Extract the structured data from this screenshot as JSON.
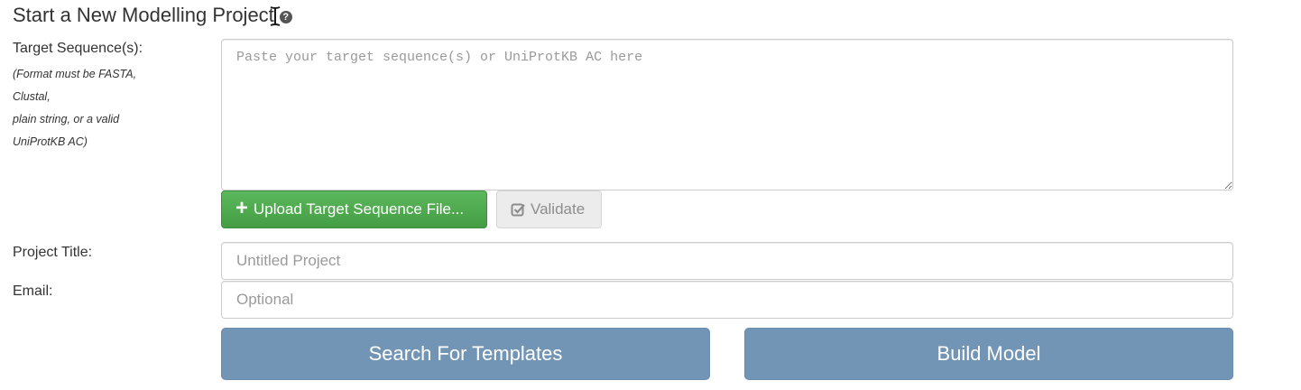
{
  "header": {
    "title": "Start a New Modelling Project",
    "help_icon": "question-circle-icon",
    "help_glyph": "?"
  },
  "form": {
    "sequence": {
      "label": "Target Sequence(s):",
      "hint_lines": [
        "(Format must be FASTA,",
        "Clustal,",
        "plain string, or a valid",
        "UniProtKB AC)"
      ],
      "placeholder": "Paste your target sequence(s) or UniProtKB AC here",
      "value": ""
    },
    "upload_button": {
      "label": "Upload Target Sequence File...",
      "icon": "plus-icon",
      "glyph": "+"
    },
    "validate_button": {
      "label": "Validate",
      "icon": "check-square-icon",
      "disabled": true
    },
    "project_title": {
      "label": "Project Title:",
      "placeholder": "Untitled Project",
      "value": ""
    },
    "email": {
      "label": "Email:",
      "placeholder": "Optional",
      "value": ""
    }
  },
  "actions": {
    "search_templates_label": "Search For Templates",
    "build_model_label": "Build Model"
  },
  "colors": {
    "upload_green": "#5cb85c",
    "action_blue": "#7395b5",
    "validate_gray": "#ececec"
  }
}
